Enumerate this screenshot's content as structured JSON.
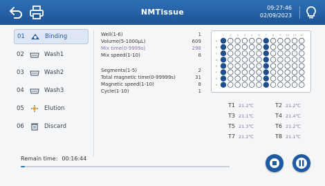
{
  "header": {
    "title": "NMTissue",
    "time": "09:27:46",
    "date": "02/09/2023"
  },
  "sidebar": {
    "items": [
      {
        "num": "01",
        "label": "Binding",
        "active": true
      },
      {
        "num": "02",
        "label": "Wash1",
        "active": false
      },
      {
        "num": "03",
        "label": "Wash2",
        "active": false
      },
      {
        "num": "04",
        "label": "Wash3",
        "active": false
      },
      {
        "num": "05",
        "label": "Elution",
        "active": false
      },
      {
        "num": "06",
        "label": "Discard",
        "active": false
      }
    ]
  },
  "params": {
    "group1": [
      {
        "label": "Well(1-6)",
        "value": "1"
      },
      {
        "label": "Volume(5-1000µL)",
        "value": "609"
      },
      {
        "label": "Mix time(0-9999s)",
        "value": "298"
      },
      {
        "label": "Mix speed(1-10)",
        "value": "8"
      }
    ],
    "group2": [
      {
        "label": "Segments(1-5)",
        "value": "2"
      },
      {
        "label": "Total magnetic time(0-99999s)",
        "value": "31"
      },
      {
        "label": "Magnetic speed(1-10)",
        "value": "8"
      },
      {
        "label": "Cycle(1-10)",
        "value": "1"
      }
    ]
  },
  "plate": {
    "rows": [
      "A",
      "B",
      "C",
      "D",
      "E",
      "F",
      "G",
      "H"
    ],
    "columns": [
      "1",
      "2",
      "3",
      "4",
      "5",
      "6",
      "7",
      "8",
      "9",
      "10",
      "11",
      "12"
    ],
    "filled_columns": [
      1,
      7
    ],
    "fill_color": "#1f4e8c"
  },
  "temperatures": [
    {
      "label": "T1",
      "value": "21.2℃"
    },
    {
      "label": "T2",
      "value": "21.2℃"
    },
    {
      "label": "T3",
      "value": "21.1℃"
    },
    {
      "label": "T4",
      "value": "21.4℃"
    },
    {
      "label": "T5",
      "value": "21.3℃"
    },
    {
      "label": "T6",
      "value": "21.2℃"
    },
    {
      "label": "T7",
      "value": "21.2℃"
    },
    {
      "label": "T8",
      "value": "21.1℃"
    }
  ],
  "status": {
    "remain_label": "Remain time:",
    "remain_value": "00:16:44",
    "progress_fraction": 0.02
  },
  "icons": {
    "back": "back-arrow-icon",
    "print": "printer-icon",
    "bulb": "lightbulb-icon",
    "stop": "stop-icon",
    "pause": "pause-icon"
  },
  "colors": {
    "header": "#1c5497",
    "accent": "#2557a3",
    "dim_text": "#8a6fa8"
  }
}
